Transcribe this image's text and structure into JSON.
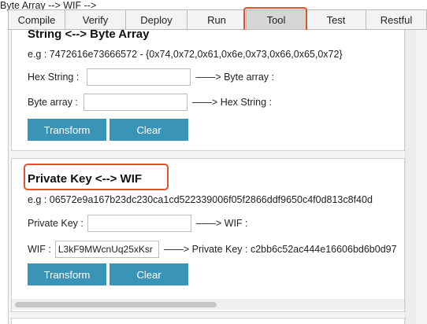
{
  "tabs": [
    {
      "label": "Compile"
    },
    {
      "label": "Verify"
    },
    {
      "label": "Deploy"
    },
    {
      "label": "Run"
    },
    {
      "label": "Tool"
    },
    {
      "label": "Test"
    },
    {
      "label": "Restful"
    }
  ],
  "active_tab": "Tool",
  "highlight_color": "#e8502c",
  "button_color": "#3a94b5",
  "string_byte_section": {
    "title": "String <--> Byte Array",
    "example": "e.g : 7472616e73666572 - {0x74,0x72,0x61,0x6e,0x73,0x66,0x65,0x72}",
    "hex_string_label": "Hex String :",
    "hex_string_value": "",
    "hex_to_byte_result": "——> Byte array :",
    "byte_array_label": "Byte array :",
    "byte_array_value": "",
    "byte_to_hex_result": "——> Hex String :",
    "transform_label": "Transform",
    "clear_label": "Clear"
  },
  "private_key_wif_section": {
    "title": "Private Key <--> WIF",
    "example": "e.g : 06572e9a167b23dc230ca1cd522339006f05f2866ddf9650c4f0d813c8f40d",
    "private_key_label": "Private Key :",
    "private_key_value": "",
    "private_key_result": "——> WIF :",
    "wif_label": "WIF :",
    "wif_value": "L3kF9MWcnUq25xKsr",
    "wif_result": "——> Private Key : c2bb6c52ac444e16606bd6b0d97",
    "transform_label": "Transform",
    "clear_label": "Clear"
  }
}
